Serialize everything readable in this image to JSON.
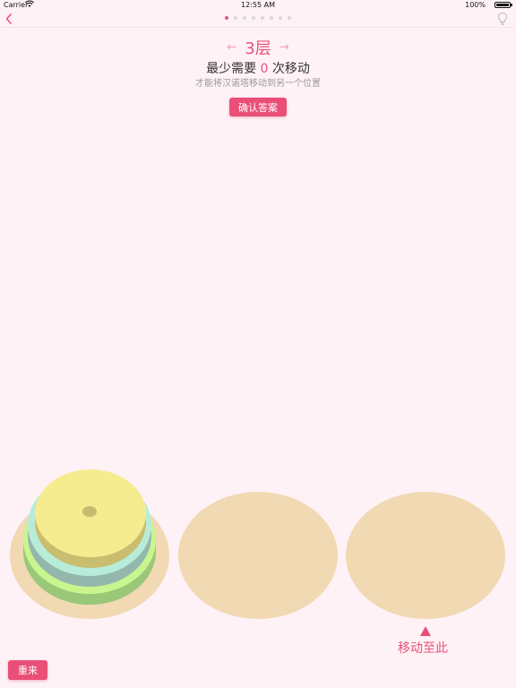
{
  "status": {
    "carrier": "Carrier",
    "time": "12:55 AM",
    "battery": "100%"
  },
  "nav": {
    "back_icon": "chevron-left-icon",
    "hint_icon": "lightbulb-icon",
    "total_pages": 8,
    "active_page": 1
  },
  "level": {
    "prev_arrow": "←",
    "label": "3层",
    "next_arrow": "→"
  },
  "requirement": {
    "prefix": "最少需要",
    "count": "0",
    "suffix": "次移动"
  },
  "subtitle": "才能将汉诺塔移动到另一个位置",
  "confirm_label": "确认答案",
  "move_here_label": "移动至此",
  "reset_label": "重来",
  "colors": {
    "accent": "#e8507a",
    "background": "#fff2f6",
    "base": "#f0d9b3",
    "disk_small": "#f5ec8f",
    "disk_medium": "#b7ecd9",
    "disk_large": "#c9f58f"
  }
}
